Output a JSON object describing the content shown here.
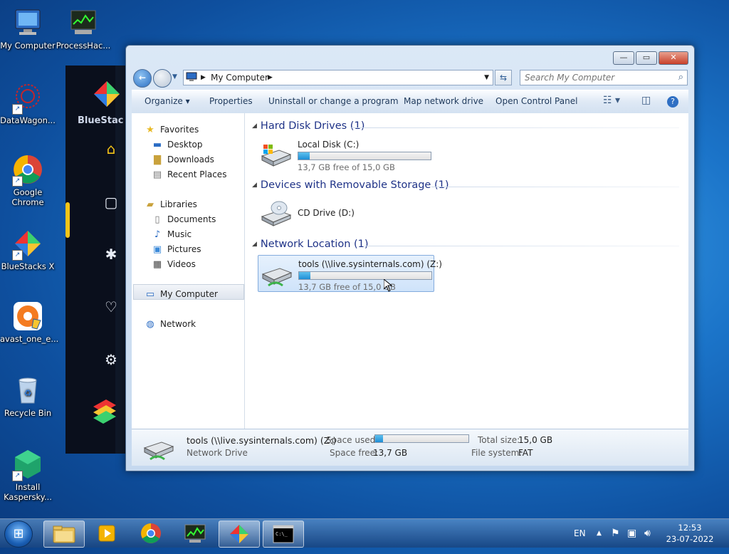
{
  "desktop": {
    "icons": [
      {
        "label": "My Computer"
      },
      {
        "label": "ProcessHac..."
      },
      {
        "label": "DataWagon..."
      },
      {
        "label": "Google Chrome"
      },
      {
        "label": "BlueStacks X"
      },
      {
        "label": "avast_one_e..."
      },
      {
        "label": "Recycle Bin"
      },
      {
        "label": "Install Kaspersky..."
      }
    ]
  },
  "bluestacks": {
    "brand": "BlueStac"
  },
  "explorer": {
    "caption_buttons": {
      "minimize": "—",
      "maximize": "▭",
      "close": "✕"
    },
    "address": {
      "location": "My Computer"
    },
    "search": {
      "placeholder": "Search My Computer"
    },
    "toolbar": {
      "organize": "Organize ▾",
      "properties": "Properties",
      "uninstall": "Uninstall or change a program",
      "map_drive": "Map network drive",
      "control_panel": "Open Control Panel"
    },
    "nav": {
      "favorites": "Favorites",
      "desktop": "Desktop",
      "downloads": "Downloads",
      "recent": "Recent Places",
      "libraries": "Libraries",
      "documents": "Documents",
      "music": "Music",
      "pictures": "Pictures",
      "videos": "Videos",
      "my_computer": "My Computer",
      "network": "Network"
    },
    "groups": {
      "hdd": "Hard Disk Drives (1)",
      "removable": "Devices with Removable Storage (1)",
      "network": "Network Location (1)"
    },
    "drives": {
      "c": {
        "name": "Local Disk (C:)",
        "free": "13,7 GB free of 15,0 GB",
        "used_fraction": 0.087
      },
      "d": {
        "name": "CD Drive (D:)"
      },
      "z": {
        "name": "tools (\\\\live.sysinternals.com) (Z:)",
        "free": "13,7 GB free of 15,0 GB",
        "used_fraction": 0.087
      }
    },
    "details": {
      "name": "tools (\\\\live.sysinternals.com) (Z:)",
      "type": "Network Drive",
      "space_used_label": "Space used:",
      "space_used_fraction": 0.087,
      "space_free_label": "Space free:",
      "space_free": "13,7 GB",
      "total_size_label": "Total size:",
      "total_size": "15,0 GB",
      "fs_label": "File system:",
      "fs": "FAT"
    }
  },
  "taskbar": {
    "language": "EN",
    "time": "12:53",
    "date": "23-07-2022"
  },
  "colors": {
    "accent": "#1f8fd6",
    "group_header": "#1e3287",
    "selection": "#cfe3fa"
  }
}
